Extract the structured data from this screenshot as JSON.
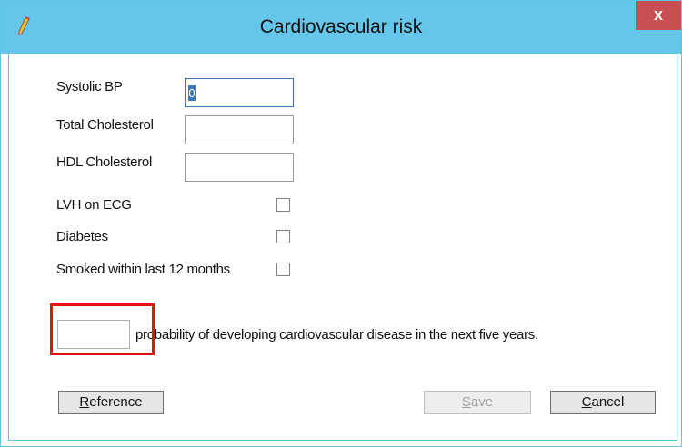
{
  "window": {
    "title": "Cardiovascular risk",
    "close_label": "x"
  },
  "form": {
    "systolic_bp": {
      "label": "Systolic BP",
      "value": "0"
    },
    "total_cholesterol": {
      "label": "Total Cholesterol",
      "value": ""
    },
    "hdl_cholesterol": {
      "label": "HDL Cholesterol",
      "value": ""
    },
    "lvh_on_ecg": {
      "label": "LVH on ECG",
      "checked": false
    },
    "diabetes": {
      "label": "Diabetes",
      "checked": false
    },
    "smoked": {
      "label": "Smoked within last 12 months",
      "checked": false
    }
  },
  "result": {
    "value": "",
    "text": "probability of developing cardiovascular disease in the next five years."
  },
  "buttons": {
    "reference": {
      "underline": "R",
      "rest": "eference"
    },
    "save": {
      "underline": "S",
      "rest": "ave"
    },
    "cancel": {
      "underline": "C",
      "rest": "ancel"
    }
  },
  "colors": {
    "titlebar": "#64c6ea",
    "close": "#c75050",
    "highlight": "#e11212"
  }
}
